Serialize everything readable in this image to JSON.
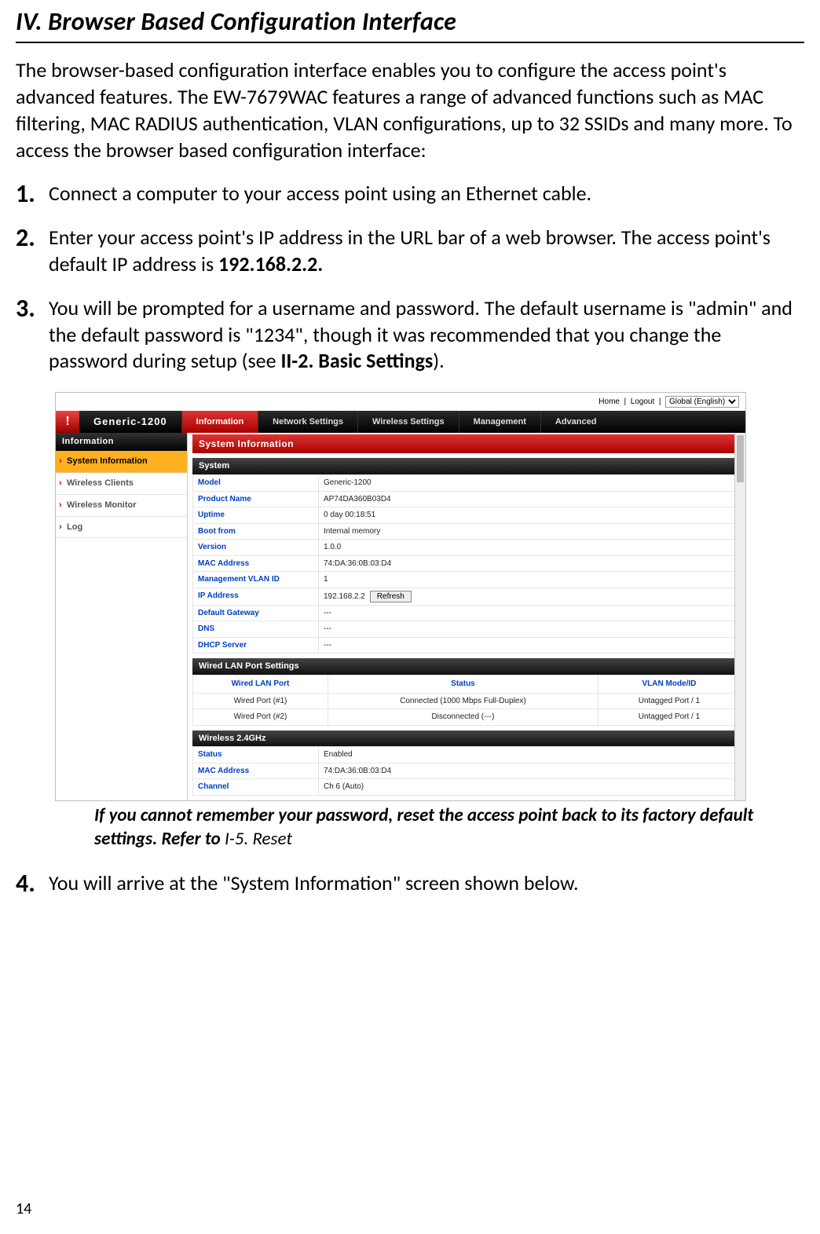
{
  "heading": "IV.    Browser Based Configuration Interface",
  "intro": "The browser-based configuration interface enables you to configure the access point's advanced features. The EW-7679WAC features a range of advanced functions such as MAC filtering, MAC RADIUS authentication, VLAN configurations, up to 32 SSIDs and many more. To access the browser based configuration interface:",
  "steps": {
    "s1": "Connect a computer to your access point using an Ethernet cable.",
    "s2_a": "Enter your access point's IP address in the URL bar of a web browser. The access point's default IP address is ",
    "s2_b": "192.168.2.2.",
    "s3_a": "You will be prompted for a username and password. The default username is \"admin\" and the default password is \"1234\", though it was recommended that you change the password during setup (see ",
    "s3_b": "II-2. Basic Settings",
    "s3_c": ").",
    "s4": "You will arrive at the \"System Information\" screen shown below."
  },
  "note_a": "If you cannot remember your password, reset the access point back to its factory default settings. Refer to ",
  "note_b": "I-5. Reset",
  "page_number": "14",
  "shot": {
    "topbar": {
      "home": "Home",
      "logout": "Logout",
      "lang": "Global (English)"
    },
    "brand": "Generic-1200",
    "nav": [
      "Information",
      "Network Settings",
      "Wireless Settings",
      "Management",
      "Advanced"
    ],
    "side_head": "Information",
    "side_items": [
      "System Information",
      "Wireless Clients",
      "Wireless Monitor",
      "Log"
    ],
    "panel_title": "System Information",
    "sub_system": "System",
    "system_rows": [
      [
        "Model",
        "Generic-1200"
      ],
      [
        "Product Name",
        "AP74DA360B03D4"
      ],
      [
        "Uptime",
        "0 day 00:18:51"
      ],
      [
        "Boot from",
        "Internal memory"
      ],
      [
        "Version",
        "1.0.0"
      ],
      [
        "MAC Address",
        "74:DA:36:0B:03:D4"
      ],
      [
        "Management VLAN ID",
        "1"
      ],
      [
        "IP Address",
        "192.168.2.2"
      ],
      [
        "Default Gateway",
        "---"
      ],
      [
        "DNS",
        "---"
      ],
      [
        "DHCP Server",
        "---"
      ]
    ],
    "refresh": "Refresh",
    "sub_lan": "Wired LAN Port Settings",
    "lan_headers": [
      "Wired LAN Port",
      "Status",
      "VLAN Mode/ID"
    ],
    "lan_rows": [
      [
        "Wired Port (#1)",
        "Connected (1000 Mbps Full-Duplex)",
        "Untagged Port  /   1"
      ],
      [
        "Wired Port (#2)",
        "Disconnected (---)",
        "Untagged Port  /   1"
      ]
    ],
    "sub_wl": "Wireless 2.4GHz",
    "wl_rows": [
      [
        "Status",
        "Enabled"
      ],
      [
        "MAC Address",
        "74:DA:36:0B:03:D4"
      ],
      [
        "Channel",
        "Ch 6 (Auto)"
      ]
    ]
  }
}
